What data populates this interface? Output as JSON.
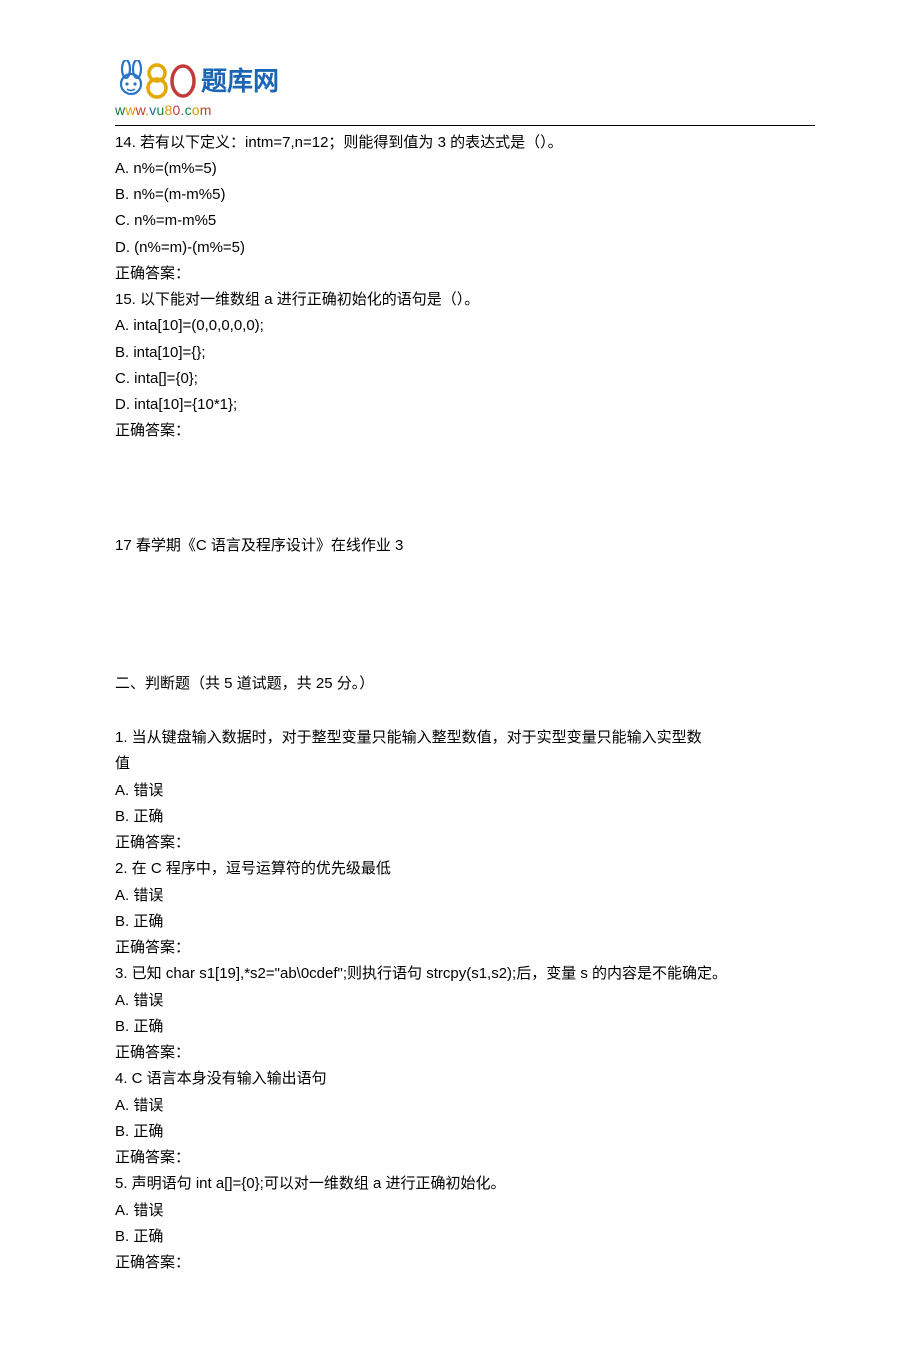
{
  "logo": {
    "brand_cn": "题库网",
    "url_chars": {
      "w1": "w",
      "w2": "w",
      "w3": "w",
      "dot1": ".",
      "v": "v",
      "u": "u",
      "eight": "8",
      "zero": "0",
      "dot2": ".",
      "c": "c",
      "o": "o",
      "m": "m"
    }
  },
  "section1": {
    "q14": {
      "stem": "14.    若有以下定义：intm=7,n=12；则能得到值为 3 的表达式是（）。",
      "a": "A. n%=(m%=5)",
      "b": "B. n%=(m-m%5)",
      "c": "C. n%=m-m%5",
      "d": "D. (n%=m)-(m%=5)",
      "ans": "正确答案："
    },
    "q15": {
      "stem": "15.    以下能对一维数组 a 进行正确初始化的语句是（）。",
      "a": "A. inta[10]=(0,0,0,0,0);",
      "b": "B. inta[10]={};",
      "c": "C. inta[]={0};",
      "d": "D. inta[10]={10*1};",
      "ans": "正确答案："
    }
  },
  "title2": "17 春学期《C 语言及程序设计》在线作业 3",
  "section2_header": "二、判断题（共  5  道试题，共  25  分。）",
  "section2": {
    "q1": {
      "stem1": "1.    当从键盘输入数据时，对于整型变量只能输入整型数值，对于实型变量只能输入实型数",
      "stem2": "值",
      "a": "A.  错误",
      "b": "B.  正确",
      "ans": "正确答案："
    },
    "q2": {
      "stem": "2.    在 C 程序中，逗号运算符的优先级最低",
      "a": "A.  错误",
      "b": "B.  正确",
      "ans": "正确答案："
    },
    "q3": {
      "stem": "3.    已知 char s1[19],*s2=\"ab\\0cdef\";则执行语句 strcpy(s1,s2);后，变量 s 的内容是不能确定。",
      "a": "A.  错误",
      "b": "B.  正确",
      "ans": "正确答案："
    },
    "q4": {
      "stem": "4.    C 语言本身没有输入输出语句",
      "a": "A.  错误",
      "b": "B.  正确",
      "ans": "正确答案："
    },
    "q5": {
      "stem": "5.    声明语句 int a[]={0};可以对一维数组 a 进行正确初始化。",
      "a": "A.  错误",
      "b": "B.  正确",
      "ans": "正确答案："
    }
  }
}
